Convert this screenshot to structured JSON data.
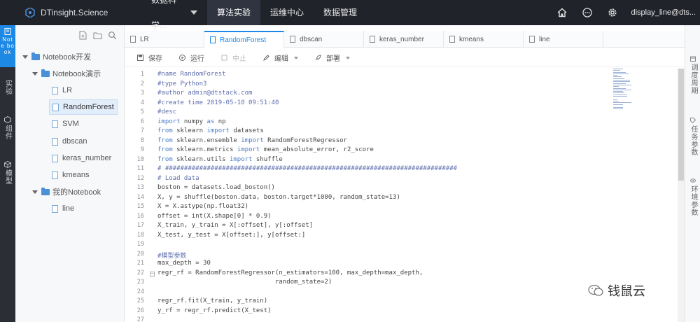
{
  "brand": {
    "name": "DTinsight.Science"
  },
  "nav": [
    {
      "label": "数据科学..."
    },
    {
      "label": "算法实验"
    },
    {
      "label": "运维中心"
    },
    {
      "label": "数据管理"
    }
  ],
  "user": {
    "email": "display_line@dts..."
  },
  "leftnav": [
    {
      "label": "Note book"
    },
    {
      "label": "实验"
    },
    {
      "label": "组件"
    },
    {
      "label": "模型"
    }
  ],
  "tree": {
    "root": "Notebook开发",
    "demo_folder": "Notebook演示",
    "demo_files": [
      "LR",
      "RandomForest",
      "SVM",
      "dbscan",
      "keras_number",
      "kmeans"
    ],
    "my_folder": "我的Notebook",
    "my_files": [
      "line"
    ]
  },
  "tabs": [
    "LR",
    "RandomForest",
    "dbscan",
    "keras_number",
    "kmeans",
    "line"
  ],
  "toolbar": {
    "save": "保存",
    "run": "运行",
    "stop": "中止",
    "edit": "编辑",
    "deploy": "部署"
  },
  "code": {
    "line_numbers": [
      "1",
      "2",
      "3",
      "4",
      "5",
      "6",
      "7",
      "8",
      "9",
      "10",
      "11",
      "12",
      "13",
      "14",
      "15",
      "16",
      "17",
      "18",
      "19",
      "20",
      "21",
      "22",
      "23",
      "24",
      "25",
      "26",
      "27"
    ],
    "l1": "#name RandomForest",
    "l2": "#type Python3",
    "l3": "#author admin@dtstack.com",
    "l4": "#create time 2019-05-10 09:51:40",
    "l5": "#desc",
    "l6a": "import",
    "l6b": " numpy ",
    "l6c": "as",
    "l6d": " np",
    "l7a": "from",
    "l7b": " sklearn ",
    "l7c": "import",
    "l7d": " datasets",
    "l8a": "from",
    "l8b": " sklearn.ensemble ",
    "l8c": "import",
    "l8d": " RandomForestRegressor",
    "l9a": "from",
    "l9b": " sklearn.metrics ",
    "l9c": "import",
    "l9d": " mean_absolute_error, r2_score",
    "l10a": "from",
    "l10b": " sklearn.utils ",
    "l10c": "import",
    "l10d": " shuffle",
    "l11": "# #############################################################################",
    "l12": "# Load data",
    "l13": "boston = datasets.load_boston()",
    "l14": "X, y = shuffle(boston.data, boston.target*1000, random_state=13)",
    "l15": "X = X.astype(np.float32)",
    "l16": "offset = int(X.shape[0] * 0.9)",
    "l17": "X_train, y_train = X[:offset], y[:offset]",
    "l18": "X_test, y_test = X[offset:], y[offset:]",
    "l19": "",
    "l20": "#模型参数",
    "l21": "max_depth = 30",
    "l22": "regr_rf = RandomForestRegressor(n_estimators=100, max_depth=max_depth,",
    "l23": "                               random_state=2)",
    "l24": "",
    "l25": "regr_rf.fit(X_train, y_train)",
    "l26": "y_rf = regr_rf.predict(X_test)"
  },
  "rightpanel": [
    {
      "label": "调度周期"
    },
    {
      "label": "任务参数"
    },
    {
      "label": "环境参数"
    }
  ],
  "watermark": {
    "text": "钱鼠云"
  }
}
